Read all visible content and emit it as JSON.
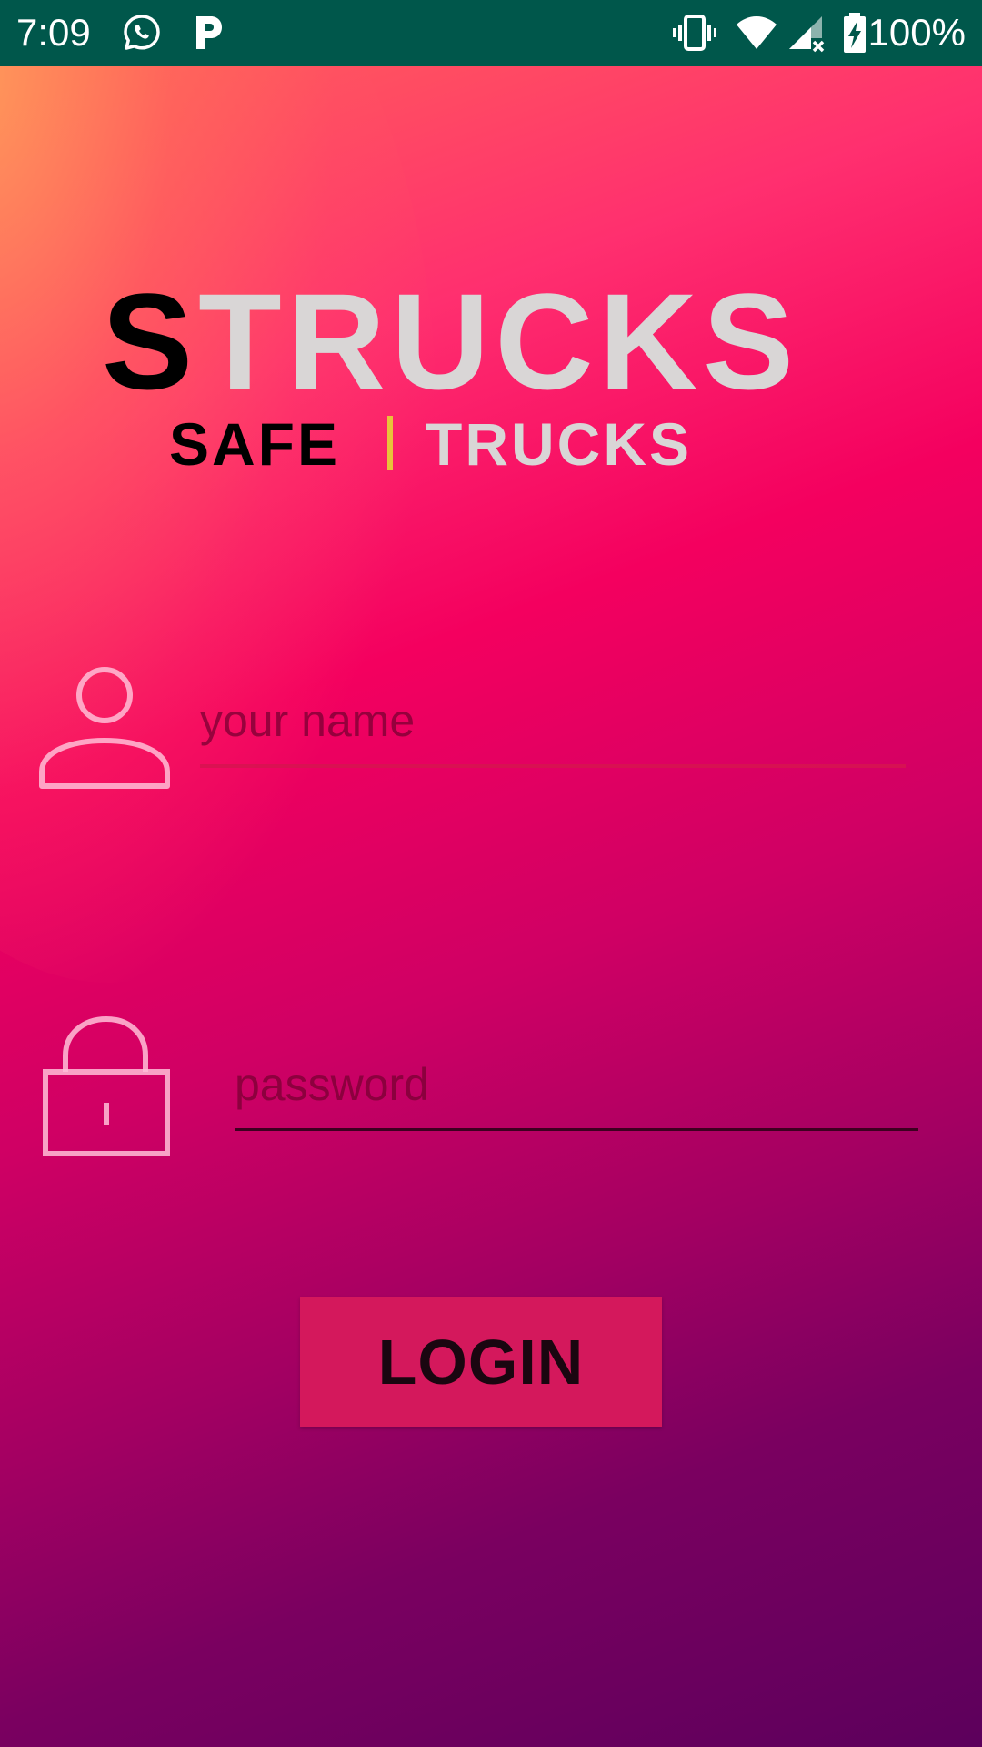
{
  "status_bar": {
    "time": "7:09",
    "battery_percent": "100%",
    "notification_icons": [
      "whatsapp-icon",
      "parking-app-icon"
    ],
    "system_icons": [
      "vibrate-icon",
      "wifi-icon",
      "cell-signal-no-data-icon",
      "battery-charging-icon"
    ],
    "background_color": "#00574b"
  },
  "logo": {
    "first_letter": "S",
    "rest": "TRUCKS",
    "sub_left": "SAFE",
    "sub_right": "TRUCKS",
    "divider_color": "#e8c23a"
  },
  "form": {
    "username": {
      "placeholder": "your name",
      "value": "",
      "icon": "user-icon"
    },
    "password": {
      "placeholder": "password",
      "value": "",
      "icon": "lock-icon"
    },
    "login_label": "LOGIN"
  },
  "colors": {
    "gradient_top": "#ff6a55",
    "gradient_mid": "#f4005f",
    "gradient_bottom": "#5c005c",
    "button_background": "#d4185c"
  }
}
